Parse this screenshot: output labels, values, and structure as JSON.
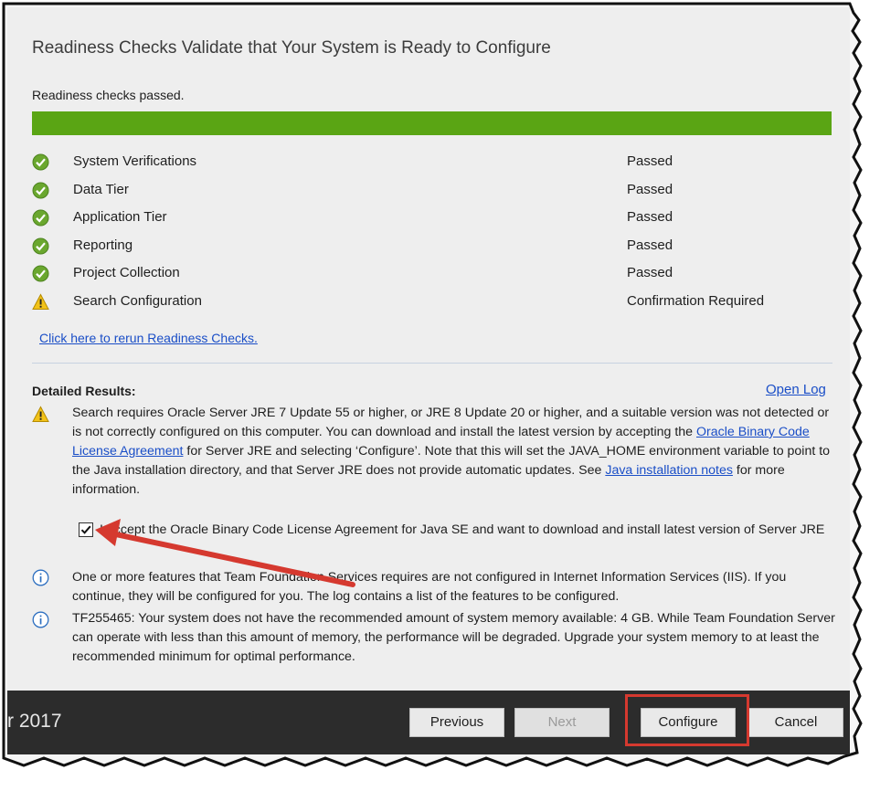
{
  "heading": "Readiness Checks Validate that Your System is Ready to Configure",
  "status_text": "Readiness checks passed.",
  "progress": 1.0,
  "colors": {
    "progress": "#5aa514",
    "link": "#1a4ec7",
    "highlight": "#d5392f",
    "footer": "#2c2c2c"
  },
  "checks": [
    {
      "name": "System Verifications",
      "status": "Passed",
      "icon": "check-circle-icon"
    },
    {
      "name": "Data Tier",
      "status": "Passed",
      "icon": "check-circle-icon"
    },
    {
      "name": "Application Tier",
      "status": "Passed",
      "icon": "check-circle-icon"
    },
    {
      "name": "Reporting",
      "status": "Passed",
      "icon": "check-circle-icon"
    },
    {
      "name": "Project Collection",
      "status": "Passed",
      "icon": "check-circle-icon"
    },
    {
      "name": "Search Configuration",
      "status": "Confirmation Required",
      "icon": "warning-icon"
    }
  ],
  "rerun_link": "Click here to rerun Readiness Checks.",
  "detailed_results_label": "Detailed Results:",
  "open_log_link": "Open Log",
  "messages": {
    "search": {
      "icon": "warning-icon",
      "part1": "Search requires Oracle Server JRE 7 Update 55 or higher, or JRE 8 Update 20 or higher, and a suitable version was not detected or is not correctly configured on this computer. You can download and install the latest version by accepting the ",
      "link1": "Oracle Binary Code License Agreement",
      "part2": " for Server JRE and selecting ‘Configure’. Note that this will set the JAVA_HOME environment variable to point to the Java installation directory, and that Server JRE does not provide automatic updates. See ",
      "link2": "Java installation notes",
      "part3": " for more information."
    },
    "accept": {
      "checked": true,
      "text": "I accept the Oracle Binary Code License Agreement for Java SE and want to download and install latest version of Server JRE"
    },
    "iis": {
      "icon": "info-icon",
      "text": "One or more features that Team Foundation Services requires are not configured in Internet Information Services (IIS). If you continue, they will be configured for you. The log contains a list of the features to be configured."
    },
    "memory": {
      "icon": "info-icon",
      "text": "TF255465: Your system does not have the recommended amount of system memory available: 4 GB. While Team Foundation Server can operate with less than this amount of memory, the performance will be degraded. Upgrade your system memory to at least the recommended minimum for optimal performance."
    }
  },
  "footer": {
    "product": "r 2017",
    "buttons": {
      "previous": "Previous",
      "next": "Next",
      "configure": "Configure",
      "cancel": "Cancel"
    }
  }
}
